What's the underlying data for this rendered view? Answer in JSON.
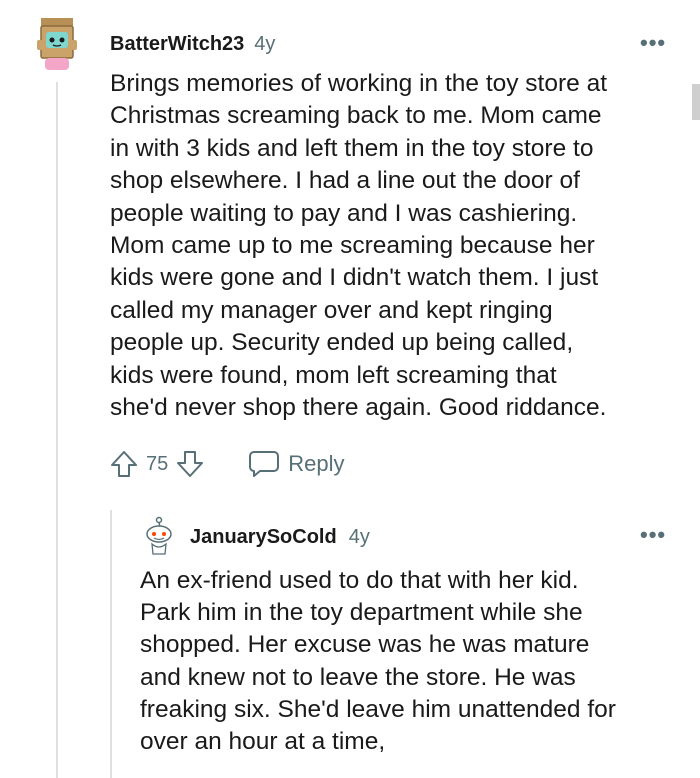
{
  "comment": {
    "author": "BatterWitch23",
    "age": "4y",
    "more_label": "•••",
    "body_lines": [
      "Brings memories of working in the toy store at",
      "Christmas screaming back to me. Mom came",
      "in with 3 kids and left them in the toy store to",
      "shop elsewhere. I had a line out the door of",
      "people waiting to pay and I was cashiering.",
      "Mom came up to me screaming because her",
      "kids were gone and I didn't watch them. I just",
      "called my manager over and kept ringing",
      "people up. Security ended up being called,",
      "kids were found, mom left screaming that",
      "she'd never shop there again. Good riddance."
    ],
    "vote_count": "75",
    "reply_label": "Reply"
  },
  "reply": {
    "author": "JanuarySoCold",
    "age": "4y",
    "more_label": "•••",
    "body_lines": [
      "An ex-friend used to do that with her kid.",
      "Park him in the toy department while she",
      "shopped. Her excuse was he was mature",
      "and knew not to leave the store. He was",
      "freaking six. She'd leave him unattended for",
      "over an hour at a time,"
    ]
  },
  "colors": {
    "text": "#1a1a1b",
    "meta": "#576f76",
    "avatar_box": "#c9a36a",
    "avatar_face": "#7fd6cf",
    "avatar_pink": "#f3a6c8"
  },
  "icons": {
    "upvote": "arrow-up-outline-icon",
    "downvote": "arrow-down-outline-icon",
    "reply": "speech-bubble-icon",
    "more": "ellipsis-icon"
  }
}
